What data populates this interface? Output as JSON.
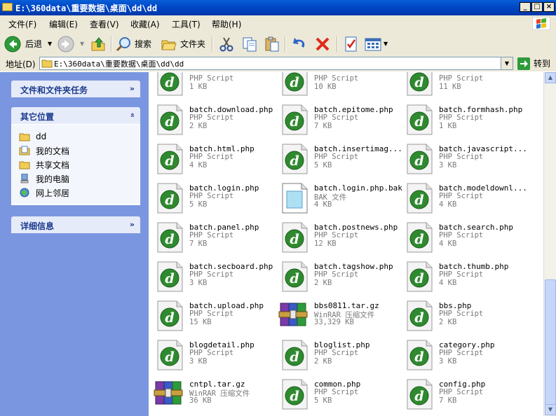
{
  "window": {
    "title": "E:\\360data\\重要数据\\桌面\\dd\\dd"
  },
  "menu": [
    "文件(F)",
    "编辑(E)",
    "查看(V)",
    "收藏(A)",
    "工具(T)",
    "帮助(H)"
  ],
  "toolbar": {
    "back": "后退",
    "search": "搜索",
    "folders": "文件夹"
  },
  "address": {
    "label": "地址(D)",
    "path": "E:\\360data\\重要数据\\桌面\\dd\\dd",
    "go": "转到"
  },
  "tasks": {
    "file_tasks_title": "文件和文件夹任务",
    "other_places_title": "其它位置",
    "other_places": [
      "dd",
      "我的文档",
      "共享文档",
      "我的电脑",
      "网上邻居"
    ],
    "details_title": "详细信息"
  },
  "files": [
    {
      "name": "",
      "type": "PHP Script",
      "size": "1 KB",
      "icon": "dreamweaver-php-icon"
    },
    {
      "name": "",
      "type": "PHP Script",
      "size": "10 KB",
      "icon": "dreamweaver-php-icon"
    },
    {
      "name": "",
      "type": "PHP Script",
      "size": "11 KB",
      "icon": "dreamweaver-php-icon"
    },
    {
      "name": "batch.download.php",
      "type": "PHP Script",
      "size": "2 KB",
      "icon": "dreamweaver-php-icon"
    },
    {
      "name": "batch.epitome.php",
      "type": "PHP Script",
      "size": "7 KB",
      "icon": "dreamweaver-php-icon"
    },
    {
      "name": "batch.formhash.php",
      "type": "PHP Script",
      "size": "1 KB",
      "icon": "dreamweaver-php-icon"
    },
    {
      "name": "batch.html.php",
      "type": "PHP Script",
      "size": "4 KB",
      "icon": "dreamweaver-php-icon"
    },
    {
      "name": "batch.insertimag...",
      "type": "PHP Script",
      "size": "5 KB",
      "icon": "dreamweaver-php-icon"
    },
    {
      "name": "batch.javascript...",
      "type": "PHP Script",
      "size": "3 KB",
      "icon": "dreamweaver-php-icon"
    },
    {
      "name": "batch.login.php",
      "type": "PHP Script",
      "size": "5 KB",
      "icon": "dreamweaver-php-icon"
    },
    {
      "name": "batch.login.php.bak",
      "type": "BAK 文件",
      "size": "4 KB",
      "icon": "generic-file-icon"
    },
    {
      "name": "batch.modeldownl...",
      "type": "PHP Script",
      "size": "4 KB",
      "icon": "dreamweaver-php-icon"
    },
    {
      "name": "batch.panel.php",
      "type": "PHP Script",
      "size": "7 KB",
      "icon": "dreamweaver-php-icon"
    },
    {
      "name": "batch.postnews.php",
      "type": "PHP Script",
      "size": "12 KB",
      "icon": "dreamweaver-php-icon"
    },
    {
      "name": "batch.search.php",
      "type": "PHP Script",
      "size": "4 KB",
      "icon": "dreamweaver-php-icon"
    },
    {
      "name": "batch.secboard.php",
      "type": "PHP Script",
      "size": "3 KB",
      "icon": "dreamweaver-php-icon"
    },
    {
      "name": "batch.tagshow.php",
      "type": "PHP Script",
      "size": "2 KB",
      "icon": "dreamweaver-php-icon"
    },
    {
      "name": "batch.thumb.php",
      "type": "PHP Script",
      "size": "4 KB",
      "icon": "dreamweaver-php-icon"
    },
    {
      "name": "batch.upload.php",
      "type": "PHP Script",
      "size": "15 KB",
      "icon": "dreamweaver-php-icon"
    },
    {
      "name": "bbs0811.tar.gz",
      "type": "WinRAR 压缩文件",
      "size": "33,329 KB",
      "icon": "winrar-archive-icon"
    },
    {
      "name": "bbs.php",
      "type": "PHP Script",
      "size": "2 KB",
      "icon": "dreamweaver-php-icon"
    },
    {
      "name": "blogdetail.php",
      "type": "PHP Script",
      "size": "3 KB",
      "icon": "dreamweaver-php-icon"
    },
    {
      "name": "bloglist.php",
      "type": "PHP Script",
      "size": "2 KB",
      "icon": "dreamweaver-php-icon"
    },
    {
      "name": "category.php",
      "type": "PHP Script",
      "size": "3 KB",
      "icon": "dreamweaver-php-icon"
    },
    {
      "name": "cntpl.tar.gz",
      "type": "WinRAR 压缩文件",
      "size": "36 KB",
      "icon": "winrar-archive-icon"
    },
    {
      "name": "common.php",
      "type": "PHP Script",
      "size": "5 KB",
      "icon": "dreamweaver-php-icon"
    },
    {
      "name": "config.php",
      "type": "PHP Script",
      "size": "7 KB",
      "icon": "dreamweaver-php-icon"
    }
  ]
}
